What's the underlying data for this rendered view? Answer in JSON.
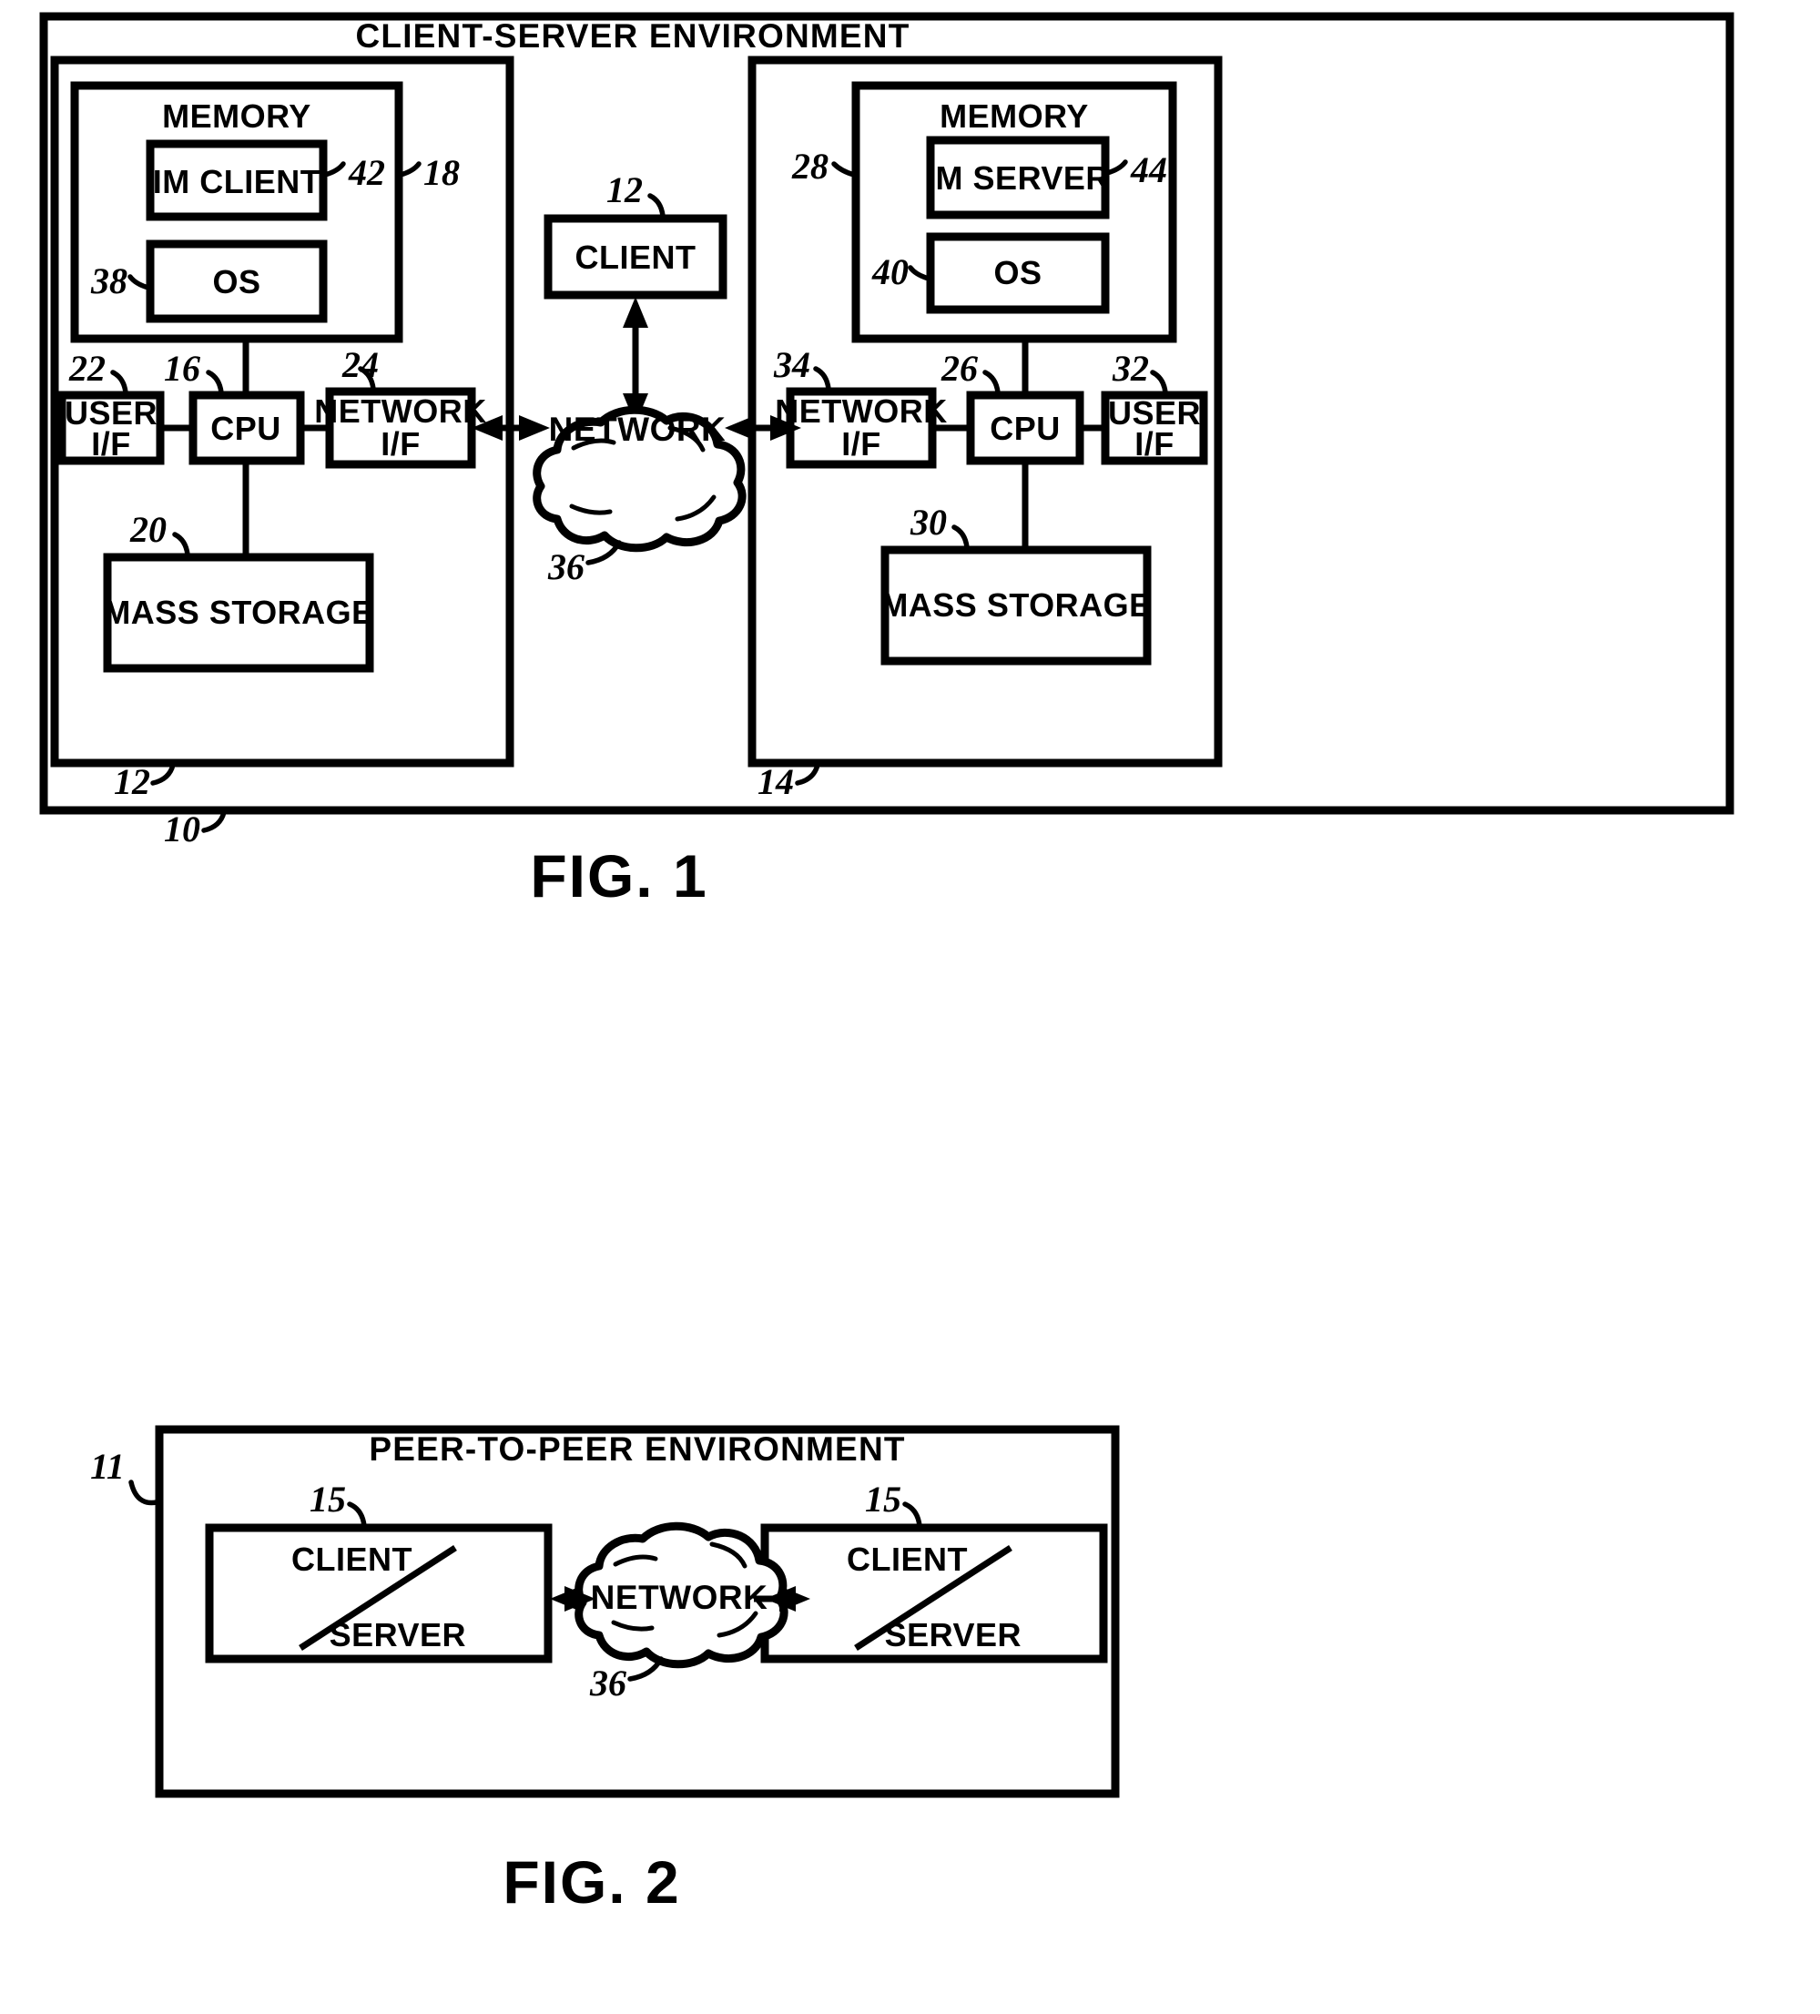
{
  "document": {
    "type": "patent-drawing-sheet",
    "figures": [
      {
        "id": "fig1",
        "caption": "FIG. 1",
        "title": "CLIENT-SERVER ENVIRONMENT",
        "outer_ref": "10",
        "blocks": {
          "client_system": {
            "ref": "12",
            "memory": {
              "label": "MEMORY",
              "ref": "18",
              "items": [
                {
                  "label": "IM CLIENT",
                  "ref": "42"
                },
                {
                  "label": "OS",
                  "ref": "38"
                }
              ]
            },
            "user_if": {
              "label_line1": "USER",
              "label_line2": "I/F",
              "ref": "22"
            },
            "cpu": {
              "label": "CPU",
              "ref": "16"
            },
            "network_if": {
              "label_line1": "NETWORK",
              "label_line2": "I/F",
              "ref": "24"
            },
            "mass_storage": {
              "label": "MASS STORAGE",
              "ref": "20"
            }
          },
          "server_system": {
            "ref": "14",
            "memory": {
              "label": "MEMORY",
              "ref": "28",
              "items": [
                {
                  "label": "IM SERVER",
                  "ref": "44"
                },
                {
                  "label": "OS",
                  "ref": "40"
                }
              ]
            },
            "user_if": {
              "label_line1": "USER",
              "label_line2": "I/F",
              "ref": "32"
            },
            "cpu": {
              "label": "CPU",
              "ref": "26"
            },
            "network_if": {
              "label_line1": "NETWORK",
              "label_line2": "I/F",
              "ref": "34"
            },
            "mass_storage": {
              "label": "MASS STORAGE",
              "ref": "30"
            }
          },
          "client_node": {
            "label": "CLIENT",
            "ref": "12"
          },
          "network_cloud": {
            "label": "NETWORK",
            "ref": "36"
          }
        }
      },
      {
        "id": "fig2",
        "caption": "FIG. 2",
        "title": "PEER-TO-PEER ENVIRONMENT",
        "outer_ref": "11",
        "blocks": {
          "peer_left": {
            "label_top": "CLIENT",
            "label_bottom": "SERVER",
            "ref": "15"
          },
          "peer_right": {
            "label_top": "CLIENT",
            "label_bottom": "SERVER",
            "ref": "15"
          },
          "network_cloud": {
            "label": "NETWORK",
            "ref": "36"
          }
        }
      }
    ]
  }
}
